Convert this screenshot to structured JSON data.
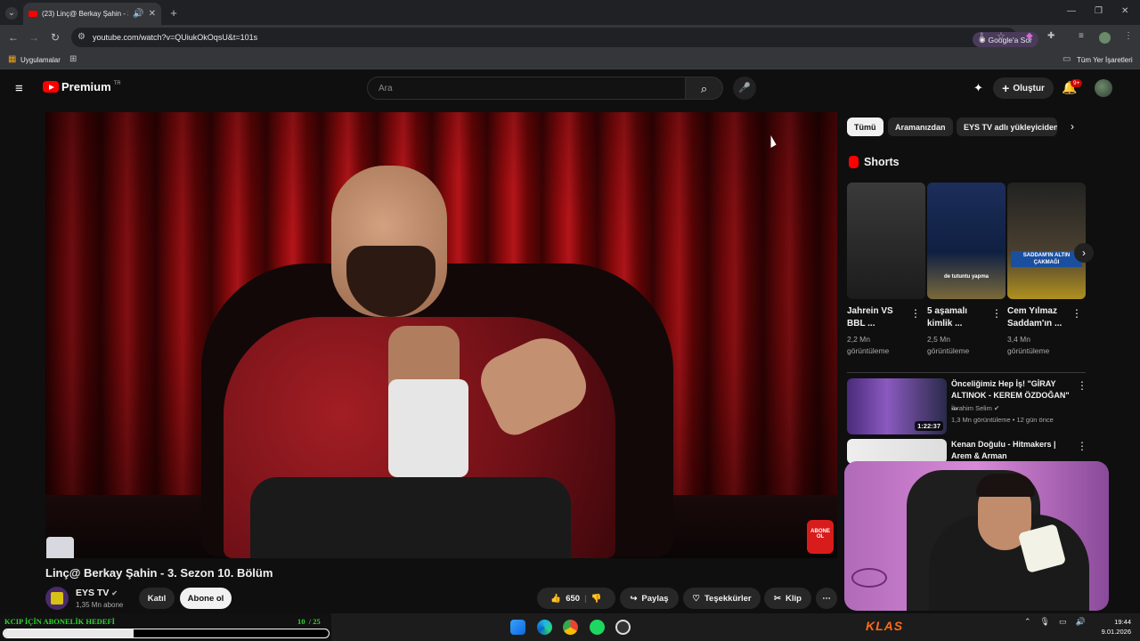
{
  "browser": {
    "tab_title": "(23) Linç@ Berkay Şahin - 3",
    "url": "youtube.com/watch?v=QUiukOkOqsU&t=101s",
    "google_ask": "Google'a Sor",
    "bookmarks": {
      "apps": "Uygulamalar",
      "all": "Tüm Yer İşaretleri"
    }
  },
  "youtube": {
    "logo_text": "Premium",
    "logo_region": "TR",
    "search_placeholder": "Ara",
    "create_label": "Oluştur",
    "notif_count": "9+"
  },
  "video": {
    "title": "Linç@ Berkay Şahin - 3. Sezon 10. Bölüm",
    "subscribe_overlay": "ABONE OL",
    "channel": {
      "name": "EYS TV",
      "subs": "1,35 Mn abone"
    },
    "buttons": {
      "join": "Katıl",
      "subscribe": "Abone ol",
      "likes": "650",
      "share": "Paylaş",
      "thanks": "Teşekkürler",
      "clip": "Klip"
    }
  },
  "chips": [
    "Tümü",
    "Aramanızdan",
    "EYS TV adlı yükleyiciden"
  ],
  "shorts": {
    "heading": "Shorts",
    "items": [
      {
        "title": "Jahrein VS BBL ...",
        "views": "2,2 Mn görüntüleme"
      },
      {
        "title": "5 aşamalı kimlik ...",
        "views": "2,5 Mn görüntüleme",
        "overlay": "de tutuntu yapma"
      },
      {
        "title": "Cem Yılmaz Saddam'ın ...",
        "views": "3,4 Mn görüntüleme",
        "overlay": "SADDAM'IN ALTIN ÇAKMAĞI"
      }
    ]
  },
  "recommended": [
    {
      "title": "Önceliğimiz Hep İş! \"GİRAY ALTINOK - KEREM ÖZDOĞAN\" ...",
      "channel": "İbrahim Selim",
      "meta": "1,3 Mn görüntüleme • 12 gün önce",
      "duration": "1:22:37"
    },
    {
      "title": "Kenan Doğulu - Hitmakers | Arem & Arman"
    }
  ],
  "stream": {
    "goal_label": "KCIP İÇİN ABONELİK HEDEFİ",
    "goal_current": "10",
    "goal_total": "/ 25",
    "goal_fraction": 0.4,
    "brand": "KLAS"
  },
  "taskbar": {
    "time": "19:44",
    "date": "9.01.2026"
  },
  "colors": {
    "yt_red": "#ff0000",
    "goal_green": "#2fd72f",
    "klas_orange": "#ff6a1a"
  }
}
